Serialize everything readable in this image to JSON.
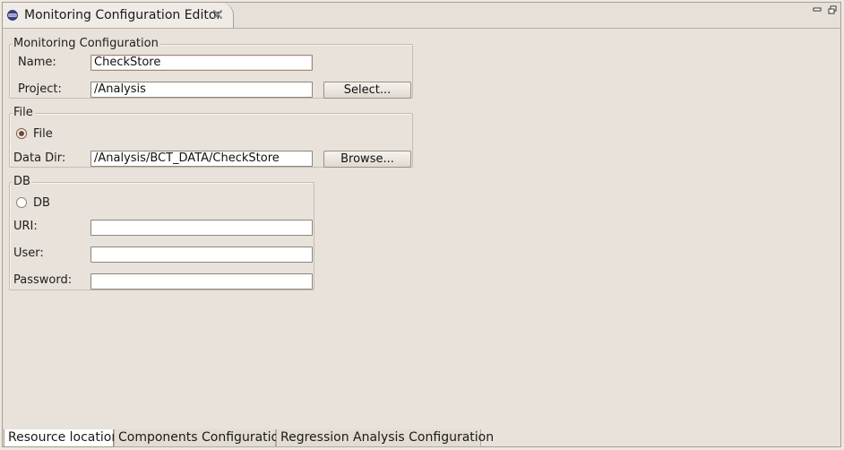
{
  "editor_tab": {
    "title": "Monitoring Configuration Editor"
  },
  "monitoring_group": {
    "title": "Monitoring Configuration",
    "name_label": "Name:",
    "name_value": "CheckStore",
    "project_label": "Project:",
    "project_value": "/Analysis",
    "select_button": "Select..."
  },
  "file_group": {
    "title": "File",
    "radio_label": "File",
    "radio_selected": true,
    "data_dir_label": "Data Dir:",
    "data_dir_value": "/Analysis/BCT_DATA/CheckStore",
    "browse_button": "Browse..."
  },
  "db_group": {
    "title": "DB",
    "radio_label": "DB",
    "radio_selected": false,
    "uri_label": "URI:",
    "uri_value": "",
    "user_label": "User:",
    "user_value": "",
    "password_label": "Password:",
    "password_value": ""
  },
  "bottom_tabs": [
    {
      "label": "Resource location",
      "active": true
    },
    {
      "label": "Components Configuration",
      "active": false
    },
    {
      "label": "Regression Analysis Configuration",
      "active": false
    }
  ],
  "icons": {
    "editor": "eclipse-globe-icon",
    "close": "close-icon",
    "minimize": "minimize-icon",
    "maximize": "maximize-icon"
  }
}
